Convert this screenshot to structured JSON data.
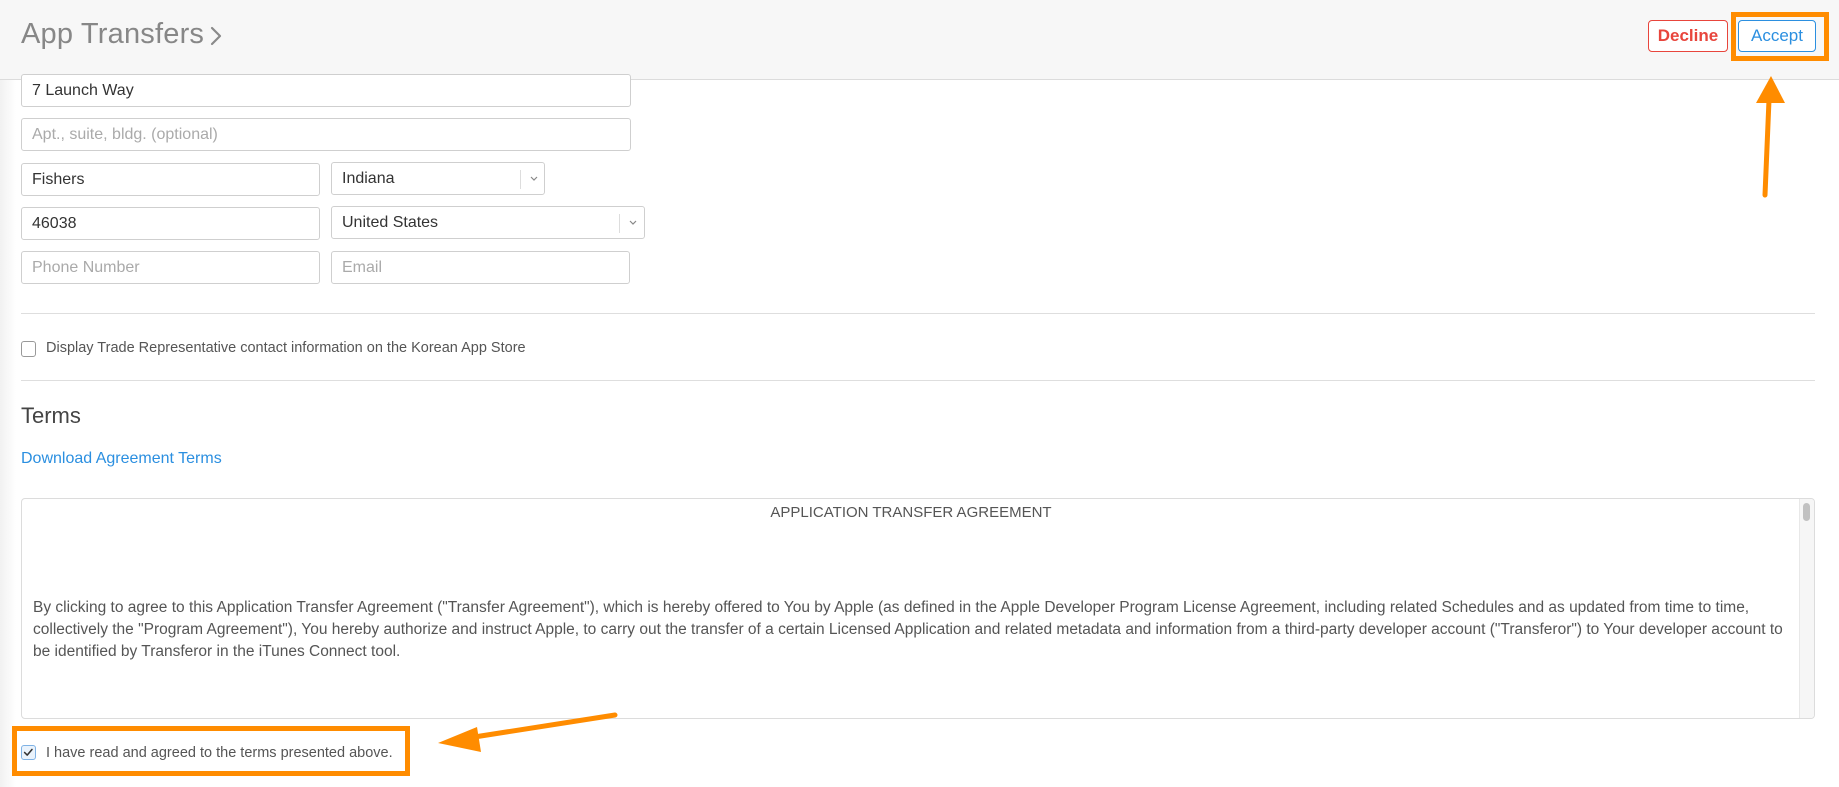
{
  "header": {
    "title": "App Transfers",
    "title_chevron_icon": "chevron-right-icon",
    "decline_label": "Decline",
    "accept_label": "Accept"
  },
  "colors": {
    "accent_blue": "#2b8fe0",
    "decline_red": "#e8453c",
    "annotation_orange": "#ff8c00"
  },
  "address_form": {
    "street": {
      "value": "7 Launch Way",
      "placeholder": ""
    },
    "apt": {
      "value": "",
      "placeholder": "Apt., suite, bldg. (optional)"
    },
    "city": {
      "value": "Fishers",
      "placeholder": ""
    },
    "state": {
      "selected": "Indiana"
    },
    "zip": {
      "value": "46038",
      "placeholder": ""
    },
    "country": {
      "selected": "United States"
    },
    "phone": {
      "value": "",
      "placeholder": "Phone Number"
    },
    "email": {
      "value": "",
      "placeholder": "Email"
    }
  },
  "korean_store_option": {
    "label": "Display Trade Representative contact information on the Korean App Store",
    "checked": false
  },
  "terms": {
    "section_title": "Terms",
    "download_link": "Download Agreement Terms",
    "agreement_heading": "APPLICATION TRANSFER AGREEMENT",
    "agreement_body": "By clicking to agree to this Application Transfer Agreement (\"Transfer Agreement\"), which is hereby offered to You by Apple (as defined in the Apple Developer Program License Agreement, including related Schedules and as updated from time to time, collectively the \"Program Agreement\"), You hereby authorize and instruct Apple, to carry out the transfer of a certain Licensed Application and related metadata and information from a third-party developer account (\"Transferor\") to Your developer account to be identified by Transferor in the iTunes Connect tool."
  },
  "agree_checkbox": {
    "label": "I have read and agreed to the terms presented above.",
    "checked": true
  },
  "annotations": [
    {
      "type": "highlight-box",
      "target": "accept-button"
    },
    {
      "type": "arrow",
      "points_to": "accept-button"
    },
    {
      "type": "highlight-box",
      "target": "agree-checkbox"
    },
    {
      "type": "arrow",
      "points_to": "agree-checkbox"
    }
  ]
}
